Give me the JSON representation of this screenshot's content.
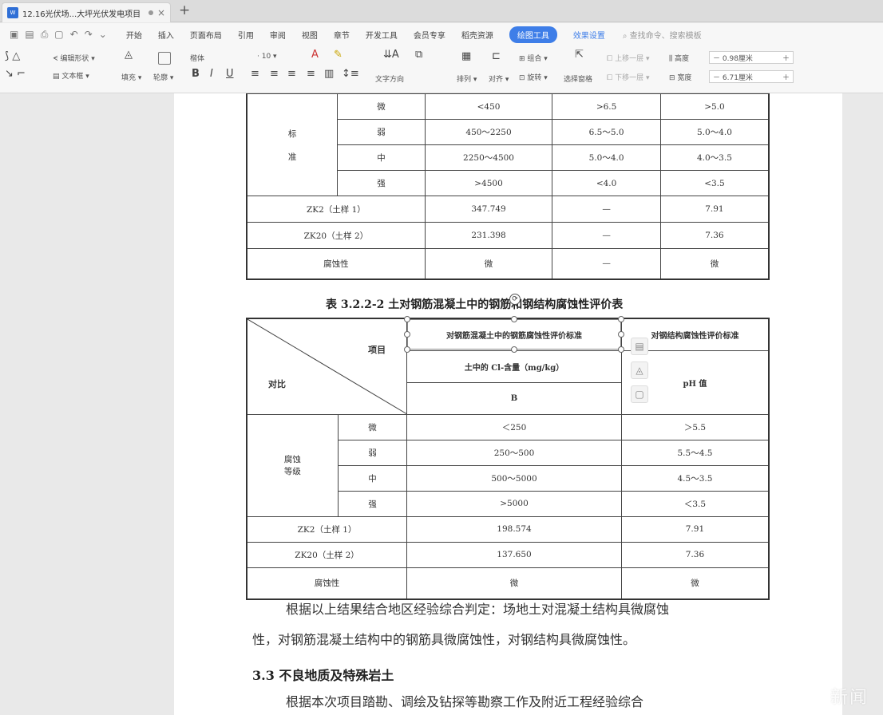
{
  "tab": {
    "title": "12.16光伏场...大坪光伏发电项目",
    "new_tab": "+"
  },
  "menu": {
    "items": [
      "开始",
      "插入",
      "页面布局",
      "引用",
      "审阅",
      "视图",
      "章节",
      "开发工具",
      "会员专享",
      "稻壳资源"
    ],
    "active": "绘图工具",
    "secondary": "效果设置",
    "search": "查找命令、搜索模板"
  },
  "ribbon": {
    "edit_shape": "编辑形状",
    "text_box": "文本框",
    "fill": "填充",
    "outline": "轮廓",
    "font": "楷体",
    "font_size": "10",
    "text_dir": "文字方向",
    "arrange": "排列",
    "align": "对齐",
    "group": "组合",
    "rotate": "旋转",
    "select_pane": "选择窗格",
    "up_one": "上移一层",
    "down_one": "下移一层",
    "height_label": "高度",
    "height_value": "0.98厘米",
    "width_label": "宽度",
    "width_value": "6.71厘米"
  },
  "table1": {
    "standard_label_1": "标",
    "standard_label_2": "准",
    "rows": [
      {
        "grade": "微",
        "c1": "<450",
        "c2": ">6.5",
        "c3": ">5.0"
      },
      {
        "grade": "弱",
        "c1": "450～2250",
        "c2": "6.5～5.0",
        "c3": "5.0～4.0"
      },
      {
        "grade": "中",
        "c1": "2250～4500",
        "c2": "5.0～4.0",
        "c3": "4.0～3.5"
      },
      {
        "grade": "强",
        "c1": ">4500",
        "c2": "<4.0",
        "c3": "<3.5"
      }
    ],
    "samples": [
      {
        "name": "ZK2（土样 1）",
        "c1": "347.749",
        "c2": "—",
        "c3": "7.91"
      },
      {
        "name": "ZK20（土样 2）",
        "c1": "231.398",
        "c2": "—",
        "c3": "7.36"
      },
      {
        "name": "腐蚀性",
        "c1": "微",
        "c2": "—",
        "c3": "微"
      }
    ]
  },
  "caption": "表 3.2.2-2 土对钢筋混凝土中的钢筋和钢结构腐蚀性评价表",
  "table2": {
    "item_label": "项目",
    "compare_label": "对比",
    "head_rebar": "对钢筋混凝土中的钢筋腐蚀性评价标准",
    "head_steel": "对钢结构腐蚀性评价标准",
    "cl_label": "土中的 Cl-含量（mg/kg）",
    "b_label": "B",
    "ph_label": "pH 值",
    "grade_label_1": "腐蚀",
    "grade_label_2": "等级",
    "rows": [
      {
        "grade": "微",
        "c1": "＜250",
        "c2": "＞5.5"
      },
      {
        "grade": "弱",
        "c1": "250～500",
        "c2": "5.5～4.5"
      },
      {
        "grade": "中",
        "c1": "500～5000",
        "c2": "4.5～3.5"
      },
      {
        "grade": "强",
        "c1": ">5000",
        "c2": "＜3.5"
      }
    ],
    "samples": [
      {
        "name": "ZK2（土样 1）",
        "c1": "198.574",
        "c2": "7.91"
      },
      {
        "name": "ZK20（土样 2）",
        "c1": "137.650",
        "c2": "7.36"
      },
      {
        "name": "腐蚀性",
        "c1": "微",
        "c2": "微"
      }
    ]
  },
  "paragraph_1": "根据以上结果结合地区经验综合判定：场地土对混凝土结构具微腐蚀",
  "paragraph_2": "性，对钢筋混凝土结构中的钢筋具微腐蚀性，对钢结构具微腐蚀性。",
  "heading_33": "3.3 不良地质及特殊岩土",
  "paragraph_3": "根据本次项目踏勘、调绘及钻探等勘察工作及附近工程经验综合",
  "watermark": "新闻"
}
